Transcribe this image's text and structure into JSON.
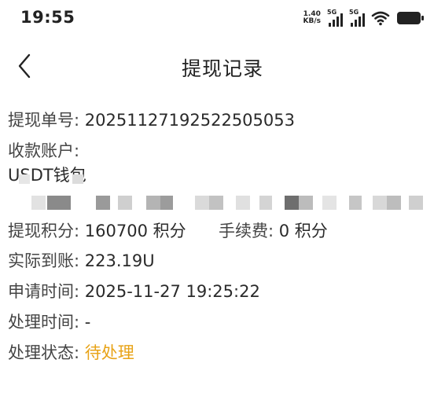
{
  "status_bar": {
    "time": "19:55",
    "net_speed_value": "1.40",
    "net_speed_unit": "KB/s",
    "sim1_label": "5G",
    "sim2_label": "5G",
    "wifi_icon": "wifi-icon",
    "battery_icon": "battery-icon"
  },
  "nav": {
    "back_icon": "chevron-left-icon",
    "title": "提现记录"
  },
  "record": {
    "order_no_label": "提现单号:",
    "order_no_value": "20251127192522505053",
    "account_label": "收款账户:",
    "account_type": "USDT钱包",
    "points_label": "提现积分:",
    "points_value": "160700 积分",
    "fee_label": "手续费:",
    "fee_value": "0 积分",
    "received_label": "实际到账:",
    "received_value": "223.19U",
    "apply_time_label": "申请时间:",
    "apply_time_value": "2025-11-27 19:25:22",
    "process_time_label": "处理时间:",
    "process_time_value": "-",
    "status_label": "处理状态:",
    "status_value": "待处理"
  },
  "colors": {
    "pending": "#e8a317",
    "text": "#333333"
  }
}
